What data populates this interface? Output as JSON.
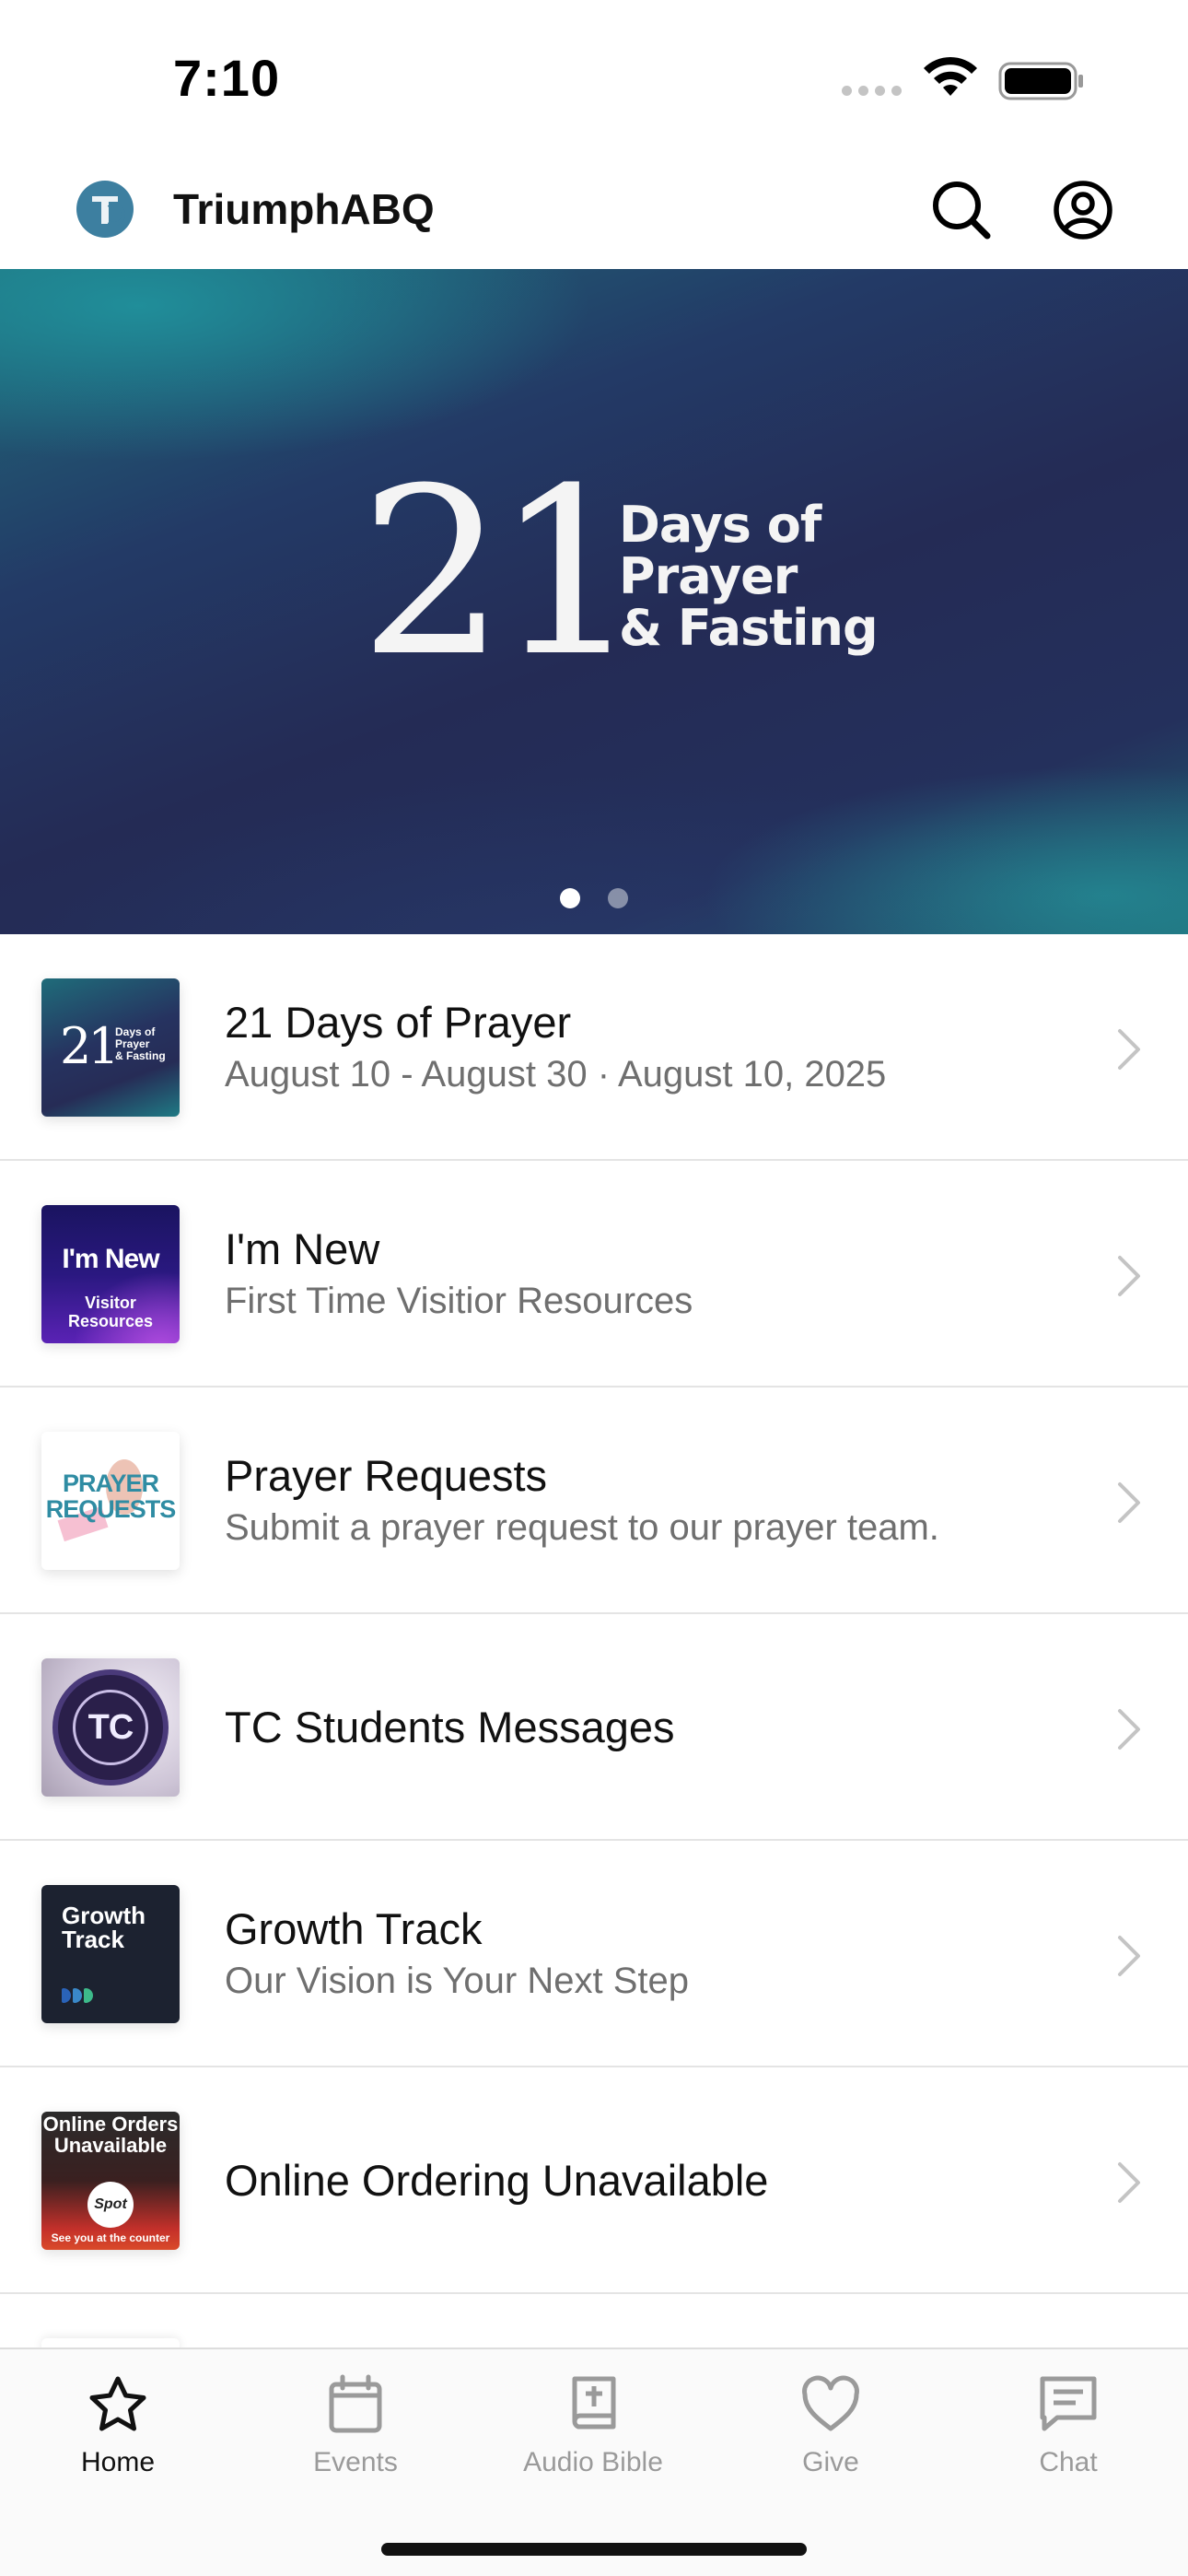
{
  "status_bar": {
    "time": "7:10"
  },
  "header": {
    "app_title": "TriumphABQ",
    "logo_icon": "triumph-logo-icon",
    "search_icon": "search-icon",
    "account_icon": "account-circle-icon"
  },
  "hero": {
    "big_number": "21",
    "line1": "Days of",
    "line2": "Prayer",
    "line3": "& Fasting",
    "page_count": 2,
    "active_page": 1
  },
  "list": {
    "items": [
      {
        "title": "21 Days of Prayer",
        "subtitle": "August 10 - August 30 · August 10, 2025",
        "thumb_num": "21",
        "thumb_words": [
          "Days of",
          "Prayer",
          "& Fasting"
        ]
      },
      {
        "title": "I'm New",
        "subtitle": "First Time Visitior Resources",
        "thumb_a": "I'm New",
        "thumb_b": "Visitor Resources"
      },
      {
        "title": "Prayer Requests",
        "subtitle": "Submit a prayer request to our prayer team.",
        "thumb_a": "PRAYER REQUESTS"
      },
      {
        "title": "TC Students Messages",
        "subtitle": "",
        "thumb_a": "TC"
      },
      {
        "title": "Growth Track",
        "subtitle": "Our Vision is Your Next Step",
        "thumb_a": "Growth Track"
      },
      {
        "title": "Online Ordering Unavailable",
        "subtitle": "",
        "thumb_a": "Online Orders Unavailable",
        "thumb_logo": "Spot",
        "thumb_b": "See you at the counter"
      }
    ]
  },
  "tab_bar": {
    "tabs": [
      {
        "label": "Home",
        "icon": "star-icon",
        "active": true
      },
      {
        "label": "Events",
        "icon": "calendar-icon",
        "active": false
      },
      {
        "label": "Audio Bible",
        "icon": "bible-icon",
        "active": false
      },
      {
        "label": "Give",
        "icon": "heart-icon",
        "active": false
      },
      {
        "label": "Chat",
        "icon": "chat-icon",
        "active": false
      }
    ]
  },
  "colors": {
    "accent_active": "#111111",
    "inactive": "#9a9a9a",
    "logo_blue": "#3d7fa0",
    "hero_teal": "#1f6c7a",
    "hero_navy": "#242b55"
  }
}
